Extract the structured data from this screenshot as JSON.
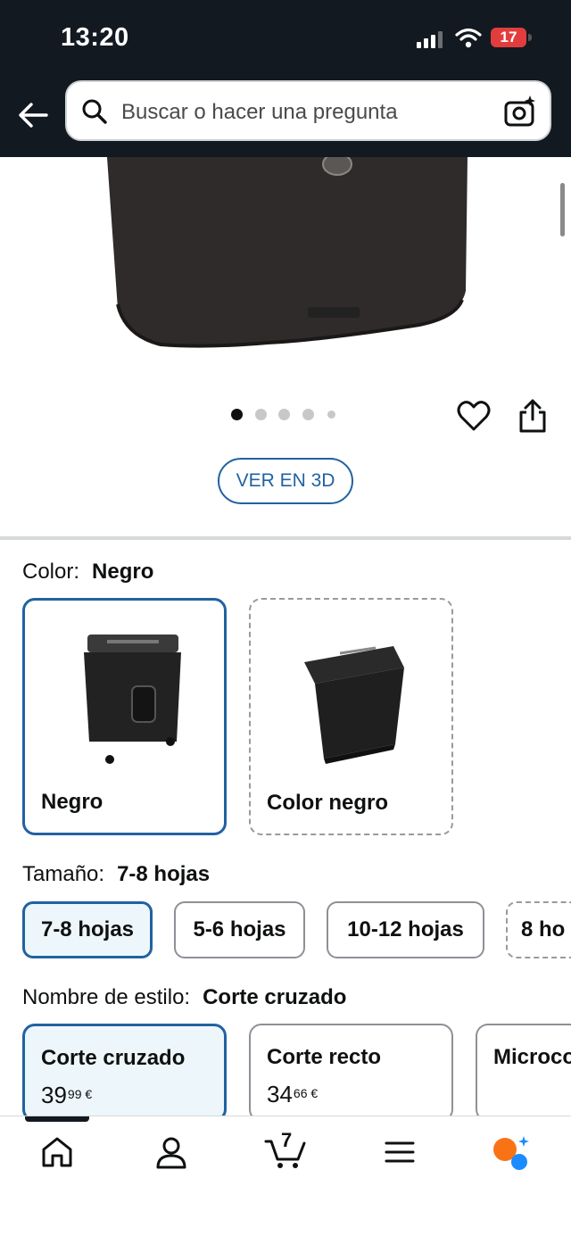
{
  "status_bar": {
    "time": "13:20",
    "battery": "17"
  },
  "search": {
    "placeholder": "Buscar o hacer una pregunta"
  },
  "gallery": {
    "dot_count": 5,
    "active_dot": 0,
    "view_3d_label": "VER EN 3D"
  },
  "color_selector": {
    "label": "Color:",
    "selected_value": "Negro",
    "options": [
      {
        "label": "Negro",
        "selected": true,
        "available": true
      },
      {
        "label": "Color negro",
        "selected": false,
        "available": false
      }
    ]
  },
  "size_selector": {
    "label": "Tamaño:",
    "selected_value": "7-8 hojas",
    "options": [
      {
        "label": "7-8 hojas",
        "selected": true
      },
      {
        "label": "5-6 hojas",
        "selected": false
      },
      {
        "label": "10-12 hojas",
        "selected": false
      },
      {
        "label": "8 ho",
        "selected": false,
        "available": false
      }
    ]
  },
  "style_selector": {
    "label": "Nombre de estilo:",
    "selected_value": "Corte cruzado",
    "options": [
      {
        "name": "Corte cruzado",
        "price_whole": "39",
        "price_cents": "99",
        "currency": "€",
        "selected": true
      },
      {
        "name": "Corte recto",
        "price_whole": "34",
        "price_cents": "66",
        "currency": "€",
        "selected": false
      },
      {
        "name": "Microco",
        "price_whole": "",
        "price_cents": "",
        "currency": "",
        "selected": false
      }
    ]
  },
  "bottom_nav": {
    "items": [
      "home-icon",
      "account-icon",
      "cart-icon",
      "menu-icon",
      "rufus-icon"
    ],
    "cart_count": "7"
  },
  "colors": {
    "header_bg": "#131921",
    "accent_blue": "#2162a1",
    "selected_bg": "#edf7fb",
    "rufus_orange": "#f97316",
    "rufus_blue": "#1a8cff"
  }
}
